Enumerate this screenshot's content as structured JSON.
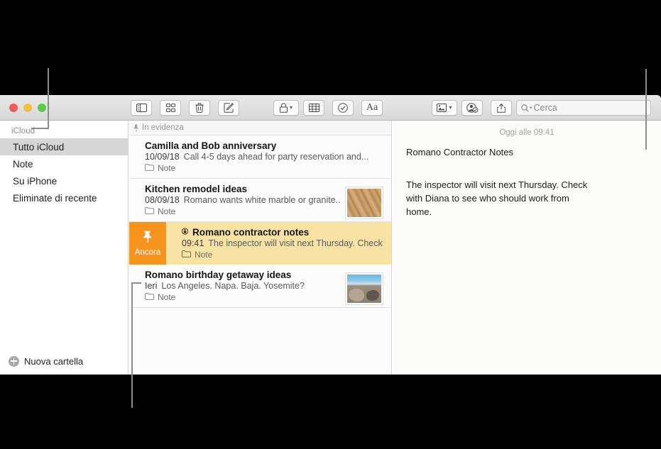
{
  "app": {
    "name": "Note",
    "window_title": "Note"
  },
  "window_controls": {
    "close": "close-button",
    "minimize": "minimize-button",
    "zoom": "zoom-button"
  },
  "toolbar": {
    "buttons": [
      {
        "id": "sidebar-toggle",
        "icon": "sidebar-icon",
        "label": "Mostra barra laterale",
        "caret": false
      },
      {
        "id": "gallery-view",
        "icon": "grid-icon",
        "label": "Vista galleria",
        "caret": false
      },
      {
        "id": "delete-note",
        "icon": "trash-icon",
        "label": "Elimina",
        "caret": false
      },
      {
        "id": "new-note",
        "icon": "compose-icon",
        "label": "Nuova nota",
        "caret": false
      },
      {
        "id": "lock-note",
        "icon": "lock-icon",
        "label": "Blocca nota",
        "caret": true
      },
      {
        "id": "insert-table",
        "icon": "table-icon",
        "label": "Tabella",
        "caret": false
      },
      {
        "id": "checklist",
        "icon": "checkmark-circle-icon",
        "label": "Elenco di controllo",
        "caret": false
      },
      {
        "id": "format-text",
        "icon": "format-text-icon",
        "label": "Aa",
        "caret": false
      },
      {
        "id": "insert-media",
        "icon": "media-icon",
        "label": "Media",
        "caret": true
      },
      {
        "id": "add-people",
        "icon": "add-person-icon",
        "label": "Aggiungi persone",
        "caret": false
      },
      {
        "id": "share",
        "icon": "share-icon",
        "label": "Condividi",
        "caret": false
      }
    ],
    "format_text_label": "Aa"
  },
  "search": {
    "placeholder": "Cerca",
    "value": "",
    "icon": "search-icon",
    "caret": "chevron-down-icon"
  },
  "sidebar": {
    "section_header": "iCloud",
    "items": [
      {
        "label": "Tutto iCloud",
        "selected": true
      },
      {
        "label": "Note",
        "selected": false
      },
      {
        "label": "Su iPhone",
        "selected": false
      },
      {
        "label": "Eliminate di recente",
        "selected": false
      }
    ],
    "footer": {
      "label": "Nuova cartella",
      "icon": "plus-circle-icon"
    }
  },
  "notes_list": {
    "header": {
      "label": "In evidenza",
      "icon": "pin-icon"
    },
    "pin_action_label": "Ancora",
    "pin_action_icon": "pin-icon",
    "folder_icon": "folder-icon",
    "rows": [
      {
        "title": "Camilla and Bob anniversary",
        "date": "10/09/18",
        "snippet": "Call 4-5 days ahead for party reservation and...",
        "folder": "Note",
        "thumb": "none",
        "locked": false,
        "pinned": false,
        "selected": false
      },
      {
        "title": "Kitchen remodel ideas",
        "date": "08/09/18",
        "snippet": "Romano wants white marble or granite...",
        "folder": "Note",
        "thumb": "wood",
        "locked": false,
        "pinned": false,
        "selected": false
      },
      {
        "title": "Romano contractor notes",
        "date": "09:41",
        "snippet": "The inspector will visit next Thursday. Check",
        "folder": "Note",
        "thumb": "none",
        "locked": true,
        "lock_icon": "lock-icon",
        "pinned": true,
        "selected": true
      },
      {
        "title": "Romano birthday getaway ideas",
        "date": "Ieri",
        "snippet": "Los Angeles. Napa. Baja. Yosemite?",
        "folder": "Note",
        "thumb": "beach",
        "locked": false,
        "pinned": false,
        "selected": false
      }
    ]
  },
  "detail": {
    "date": "Oggi alle 09:41",
    "title": "Romano Contractor Notes",
    "body": "The inspector will visit next Thursday. Check with Diana to see who should work from home."
  },
  "colors": {
    "pin_orange": "#f7941e",
    "pinned_row": "#f9e3a4",
    "selected_sidebar": "#d6d6d6",
    "callout": "#8c8c8c",
    "background": "#000000"
  }
}
